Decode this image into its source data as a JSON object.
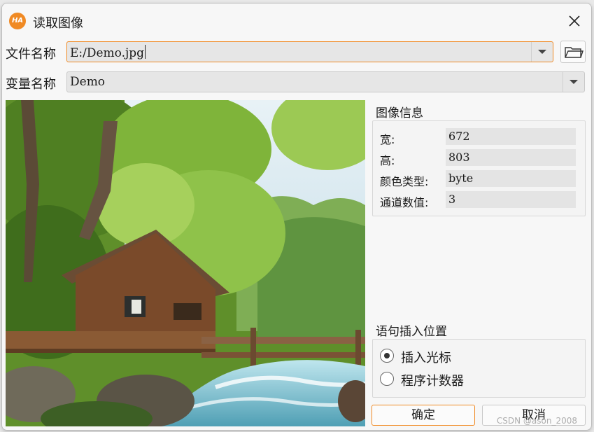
{
  "window": {
    "title": "读取图像",
    "app_logo_text": "HA",
    "close_icon": "close-icon"
  },
  "file": {
    "label": "文件名称",
    "value": "E:/Demo.jpg",
    "dropdown_icon": "chevron-down-icon",
    "browse_icon": "folder-open-icon"
  },
  "variable": {
    "label": "变量名称",
    "value": "Demo",
    "dropdown_icon": "chevron-down-icon"
  },
  "image_info": {
    "title": "图像信息",
    "rows": [
      {
        "key": "宽:",
        "value": "672"
      },
      {
        "key": "高:",
        "value": "803"
      },
      {
        "key": "颜色类型:",
        "value": "byte"
      },
      {
        "key": "通道数值:",
        "value": "3"
      }
    ]
  },
  "insert_position": {
    "title": "语句插入位置",
    "options": [
      {
        "label": "插入光标",
        "checked": true
      },
      {
        "label": "程序计数器",
        "checked": false
      }
    ]
  },
  "buttons": {
    "ok": "确定",
    "cancel": "取消"
  },
  "watermark": "CSDN @ason_2008",
  "colors": {
    "accent": "#f08a24",
    "window_bg": "#f7f7f7",
    "field_bg": "#e6e6e6"
  }
}
